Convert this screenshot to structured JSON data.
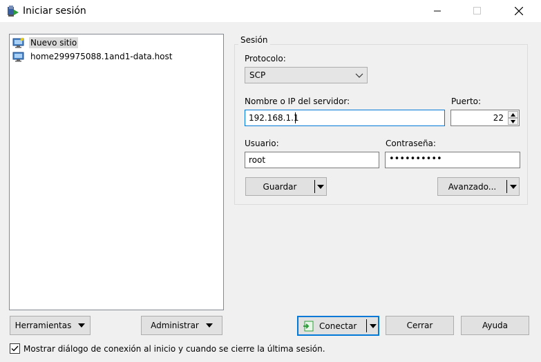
{
  "window": {
    "title": "Iniciar sesión"
  },
  "tree": {
    "items": [
      {
        "label": "Nuevo sitio",
        "selected": true,
        "icon": "new-site-icon"
      },
      {
        "label": "home299975088.1and1-data.host",
        "selected": false,
        "icon": "computer-icon"
      }
    ]
  },
  "session": {
    "legend": "Sesión",
    "protocol_label": "Protocolo:",
    "protocol_value": "SCP",
    "host_label": "Nombre o IP del servidor:",
    "host_value": "192.168.1.1",
    "port_label": "Puerto:",
    "port_value": "22",
    "user_label": "Usuario:",
    "user_value": "root",
    "password_label": "Contraseña:",
    "password_value": "••••••••••",
    "save_label": "Guardar",
    "advanced_label": "Avanzado..."
  },
  "bottom": {
    "tools_label": "Herramientas",
    "manage_label": "Administrar",
    "connect_label": "Conectar",
    "close_label": "Cerrar",
    "help_label": "Ayuda",
    "checkbox_label": "Mostrar diálogo de conexión al inicio y cuando se cierre la última sesión.",
    "checkbox_checked": true
  },
  "colors": {
    "accent": "#0078d7",
    "connect_icon": "#2e9e3a"
  }
}
